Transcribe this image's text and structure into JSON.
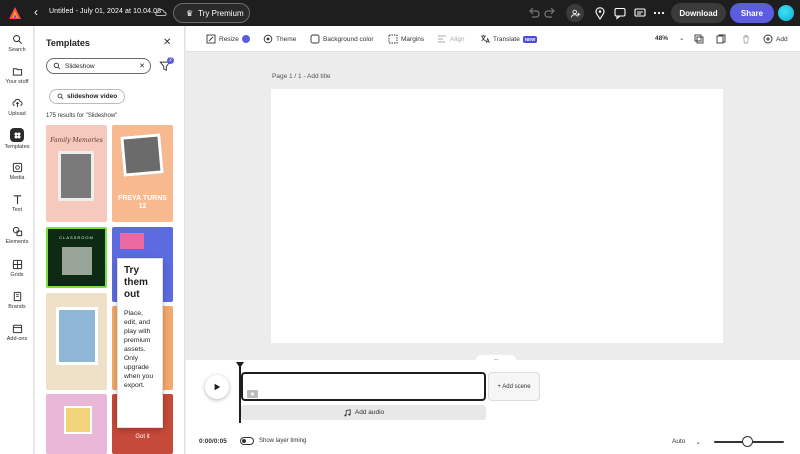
{
  "topbar": {
    "doc_title": "Untitled - July 01, 2024 at 10.04.08",
    "premium_label": "Try Premium",
    "download_label": "Download",
    "share_label": "Share"
  },
  "rail": {
    "items": [
      {
        "label": "Search",
        "icon": "search-icon"
      },
      {
        "label": "Your stuff",
        "icon": "folder-icon"
      },
      {
        "label": "Upload",
        "icon": "upload-icon"
      },
      {
        "label": "Templates",
        "icon": "templates-icon",
        "active": true
      },
      {
        "label": "Media",
        "icon": "media-icon"
      },
      {
        "label": "Text",
        "icon": "text-icon"
      },
      {
        "label": "Elements",
        "icon": "elements-icon"
      },
      {
        "label": "Grids",
        "icon": "grids-icon"
      },
      {
        "label": "Brands",
        "icon": "brands-icon"
      },
      {
        "label": "Add-ons",
        "icon": "addons-icon"
      }
    ]
  },
  "panel": {
    "title": "Templates",
    "search_value": "Slideshow",
    "filter_count": "2",
    "chip_label": "slideshow video",
    "results_text": "175 results for \"Slideshow\"",
    "thumbs": [
      {
        "text": "Family Memories",
        "bg": "#f6c9bd"
      },
      {
        "text": "FREYA TURNS 12",
        "bg": "#f7b98d"
      },
      {
        "text": "CLASSROOM",
        "bg": "#0f2a12"
      },
      {
        "text": "",
        "bg": "#5c6be0"
      },
      {
        "text": "",
        "bg": "#efe1c8"
      },
      {
        "text": "",
        "bg": "#f3a96b"
      },
      {
        "text": "",
        "bg": "#e9b7d8"
      },
      {
        "text": "Got it",
        "bg": "#c64a3a"
      }
    ],
    "tooltip": {
      "title": "Try them out",
      "body": "Place, edit, and play with premium assets. Only upgrade when you export."
    }
  },
  "toolbar": {
    "resize": "Resize",
    "theme": "Theme",
    "background": "Background color",
    "margins": "Margins",
    "align": "Align",
    "translate": "Translate",
    "new_badge": "NEW",
    "zoom": "48%",
    "add": "Add"
  },
  "canvas": {
    "page_label": "Page 1 / 1 - Add title"
  },
  "timeline": {
    "add_scene": "+ Add scene",
    "add_audio": "Add audio",
    "time": "0:00/0:05",
    "show_layer_timing": "Show layer timing",
    "auto": "Auto"
  },
  "colors": {
    "accent": "#5c5ce0",
    "topbar": "#1e1e1e"
  }
}
